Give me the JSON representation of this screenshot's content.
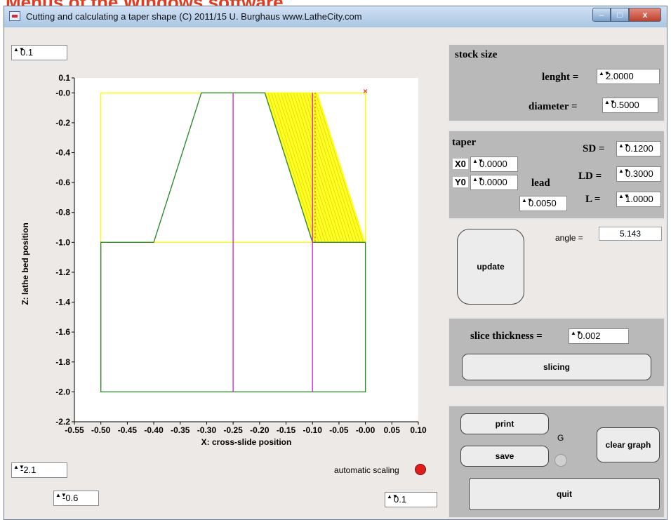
{
  "caption": "Menus of the Windows software",
  "window": {
    "title": "Cutting and calculating a taper shape   (C)  2011/15  U. Burghaus  www.LatheCity.com",
    "min_glyph": "–",
    "max_glyph": "□",
    "close_glyph": "x"
  },
  "spinners": {
    "y_top": "0.1",
    "y_bottom": "-2.1",
    "x_min": "-0.6",
    "x_max": "0.1",
    "arrow": "▲▼"
  },
  "stock_size": {
    "title": "stock size",
    "length_label": "lenght =",
    "length_value": "2.0000",
    "diameter_label": "diameter =",
    "diameter_value": "0.5000"
  },
  "taper": {
    "title": "taper",
    "x0_label": "X0",
    "x0_value": "0.0000",
    "y0_label": "Y0",
    "y0_value": "0.0000",
    "lead_label": "lead",
    "lead_value": "0.0050",
    "sd_label": "SD =",
    "sd_value": "0.1200",
    "ld_label": "LD =",
    "ld_value": "0.3000",
    "l_label": "L =",
    "l_value": "1.0000"
  },
  "angle": {
    "label": "angle  =",
    "value": "5.143"
  },
  "buttons": {
    "update": "update",
    "slicing": "slicing",
    "print": "print",
    "save": "save",
    "clear_graph": "clear graph",
    "quit": "quit",
    "g_label": "G"
  },
  "slice": {
    "label": "slice thickness =",
    "value": "0.002"
  },
  "auto_scaling": {
    "label": "automatic scaling",
    "indicator_color": "#e21b1b"
  },
  "colors": {
    "stock_outline": "#ffff00",
    "shape": "#2f8a2f",
    "centerline": "#cc33cc",
    "cut": "#ffff00",
    "marker": "#ff3333"
  },
  "chart_data": {
    "type": "line",
    "xlabel": "X: cross-slide position",
    "ylabel": "Z: lathe bed position",
    "xlim": [
      -0.55,
      0.1
    ],
    "ylim": [
      -2.2,
      0.1
    ],
    "x_ticks": [
      "-0.55",
      "-0.50",
      "-0.45",
      "-0.40",
      "-0.35",
      "-0.30",
      "-0.25",
      "-0.20",
      "-0.15",
      "-0.10",
      "-0.05",
      "-0.00",
      "0.05",
      "0.10"
    ],
    "y_ticks": [
      "0.1",
      "-0.0",
      "-0.2",
      "-0.4",
      "-0.6",
      "-0.8",
      "-1.0",
      "-1.2",
      "-1.4",
      "-1.6",
      "-1.8",
      "-2.0",
      "-2.2"
    ],
    "series": [
      {
        "role": "stock-outline",
        "color": "#ffff00",
        "x": [
          -0.5,
          0.0,
          0.0,
          -0.5,
          -0.5
        ],
        "y": [
          0.0,
          0.0,
          -1.0,
          -1.0,
          0.0
        ]
      },
      {
        "role": "taper-shape",
        "color": "#2f8a2f",
        "x": [
          -0.4,
          -0.31,
          -0.19,
          -0.1,
          0.0,
          0.0,
          -0.5,
          -0.5,
          -0.4
        ],
        "y": [
          -1.0,
          0.0,
          0.0,
          -1.0,
          -1.0,
          -2.0,
          -2.0,
          -1.0,
          -1.0
        ]
      },
      {
        "role": "centerline-1",
        "color": "#cc33cc",
        "x": [
          -0.25,
          -0.25
        ],
        "y": [
          0.0,
          -2.0
        ]
      },
      {
        "role": "centerline-2",
        "color": "#cc33cc",
        "x": [
          -0.1,
          -0.1
        ],
        "y": [
          0.0,
          -2.0
        ]
      }
    ],
    "cut_region": {
      "x": [
        -0.19,
        -0.09,
        0.0,
        -0.1
      ],
      "y": [
        0.0,
        0.0,
        -1.0,
        -1.0
      ]
    },
    "marker": {
      "x": 0.0,
      "y": 0.0
    },
    "guide": {
      "x": [
        -0.095,
        -0.095
      ],
      "y": [
        0.0,
        -1.0
      ]
    }
  }
}
